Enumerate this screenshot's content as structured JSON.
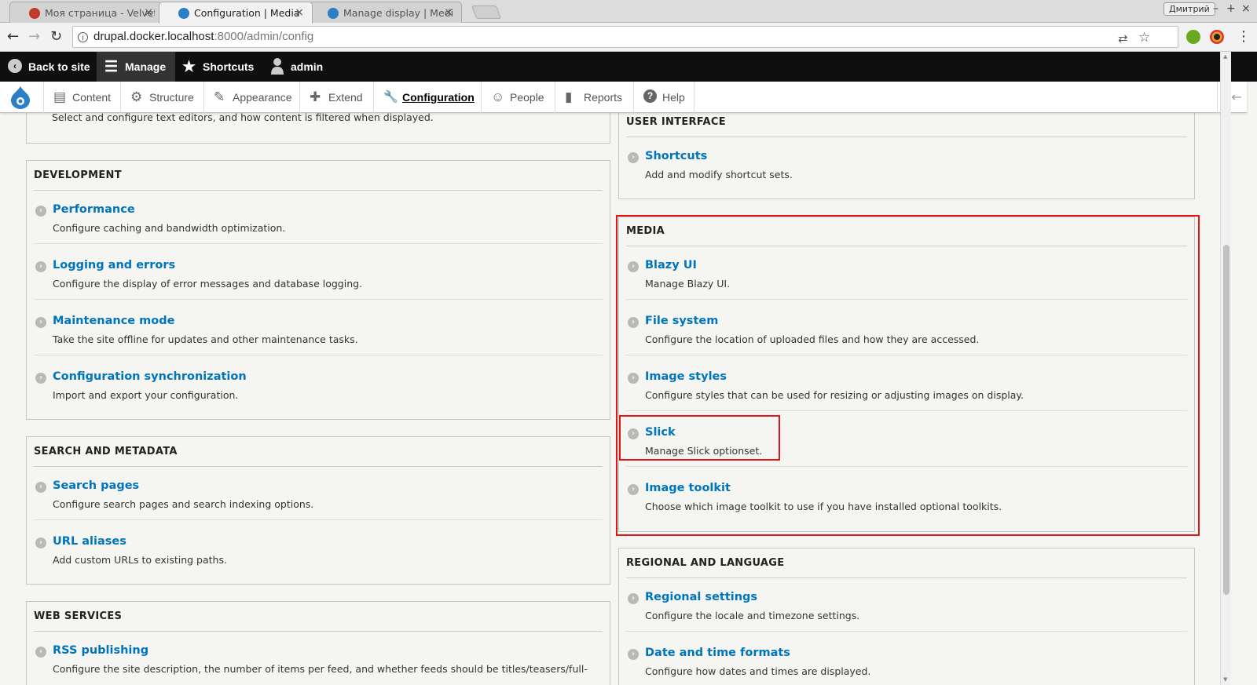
{
  "browser": {
    "tabs": [
      {
        "title": "Моя страница - Velvet",
        "favicon_color": "#c0392b"
      },
      {
        "title": "Configuration | Media",
        "favicon_color": "#2a7fc5"
      },
      {
        "title": "Manage display | Medi",
        "favicon_color": "#2a7fc5"
      }
    ],
    "close_glyph": "×",
    "user_name": "Дмитрий",
    "window_controls": [
      "–",
      "+",
      "×"
    ],
    "url_host": "drupal.docker.localhost",
    "url_path": ":8000/admin/config",
    "nav_back": "←",
    "nav_forward": "→",
    "nav_reload": "↻",
    "info_glyph": "i",
    "translate_glyph": "⇄",
    "star_glyph": "☆",
    "menu_glyph": "⋮"
  },
  "admin_toolbar": {
    "back_to_site": "Back to site",
    "manage": "Manage",
    "shortcuts": "Shortcuts",
    "user": "admin"
  },
  "tray": {
    "items": [
      {
        "label": "Content",
        "icon": "page-icon",
        "glyph": "▤"
      },
      {
        "label": "Structure",
        "icon": "structure-icon",
        "glyph": "⚙"
      },
      {
        "label": "Appearance",
        "icon": "brush-icon",
        "glyph": "✎"
      },
      {
        "label": "Extend",
        "icon": "puzzle-icon",
        "glyph": "✚"
      },
      {
        "label": "Configuration",
        "icon": "wrench-icon",
        "glyph": "🔧"
      },
      {
        "label": "People",
        "icon": "people-icon",
        "glyph": "☺"
      },
      {
        "label": "Reports",
        "icon": "chart-icon",
        "glyph": "▮"
      },
      {
        "label": "Help",
        "icon": "help-icon",
        "glyph": "?"
      }
    ],
    "collapse_glyph": "|←"
  },
  "content": {
    "top_desc": "Select and configure text editors, and how content is filtered when displayed.",
    "development": {
      "title": "DEVELOPMENT",
      "items": [
        {
          "link": "Performance",
          "desc": "Configure caching and bandwidth optimization."
        },
        {
          "link": "Logging and errors",
          "desc": "Configure the display of error messages and database logging."
        },
        {
          "link": "Maintenance mode",
          "desc": "Take the site offline for updates and other maintenance tasks."
        },
        {
          "link": "Configuration synchronization",
          "desc": "Import and export your configuration."
        }
      ]
    },
    "search": {
      "title": "SEARCH AND METADATA",
      "items": [
        {
          "link": "Search pages",
          "desc": "Configure search pages and search indexing options."
        },
        {
          "link": "URL aliases",
          "desc": "Add custom URLs to existing paths."
        }
      ]
    },
    "web_services": {
      "title": "WEB SERVICES",
      "items": [
        {
          "link": "RSS publishing",
          "desc": "Configure the site description, the number of items per feed, and whether feeds should be titles/teasers/full-"
        }
      ]
    },
    "user_interface": {
      "title": "USER INTERFACE",
      "items": [
        {
          "link": "Shortcuts",
          "desc": "Add and modify shortcut sets."
        }
      ]
    },
    "media": {
      "title": "MEDIA",
      "items": [
        {
          "link": "Blazy UI",
          "desc": "Manage Blazy UI."
        },
        {
          "link": "File system",
          "desc": "Configure the location of uploaded files and how they are accessed."
        },
        {
          "link": "Image styles",
          "desc": "Configure styles that can be used for resizing or adjusting images on display."
        },
        {
          "link": "Slick",
          "desc": "Manage Slick optionset."
        },
        {
          "link": "Image toolkit",
          "desc": "Choose which image toolkit to use if you have installed optional toolkits."
        }
      ]
    },
    "regional": {
      "title": "REGIONAL AND LANGUAGE",
      "items": [
        {
          "link": "Regional settings",
          "desc": "Configure the locale and timezone settings."
        },
        {
          "link": "Date and time formats",
          "desc": "Configure how dates and times are displayed."
        }
      ]
    },
    "bullet_glyph": "›"
  },
  "colors": {
    "link": "#0074bd",
    "highlight": "#e01515",
    "admin_bar": "#0f0f0f"
  }
}
